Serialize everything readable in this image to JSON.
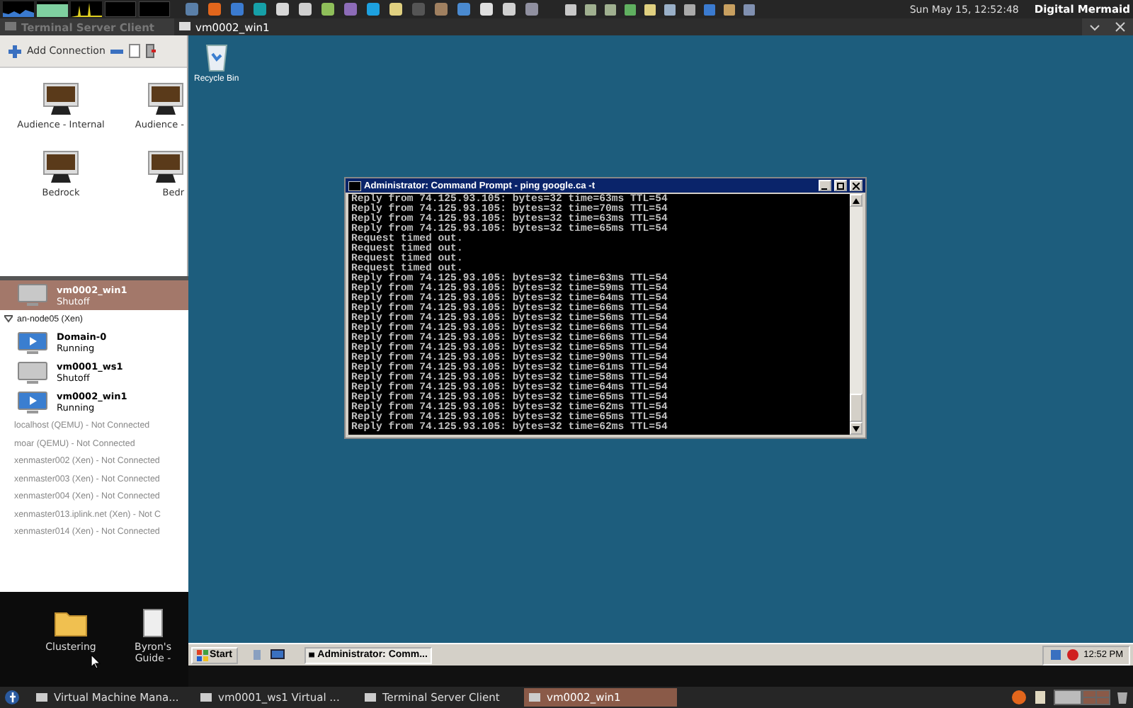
{
  "top_panel": {
    "clock": "Sun May 15, 12:52:48",
    "user": "Digital Mermaid"
  },
  "window_tabs": [
    {
      "label": "Terminal Server Client",
      "selected": false
    },
    {
      "label": "vm0002_win1",
      "selected": true
    }
  ],
  "tsclient": {
    "add_connection": "Add Connection",
    "connections": [
      {
        "label": "Audience - Internal"
      },
      {
        "label": "Audience -"
      },
      {
        "label": "Bedrock"
      },
      {
        "label": "Bedr"
      }
    ]
  },
  "virt_manager": {
    "vms": [
      {
        "name": "vm0002_win1",
        "status": "Shutoff",
        "running": false,
        "selected": true
      }
    ],
    "hosts": [
      {
        "label": "an-node05 (Xen)",
        "connected": true,
        "expanded": true,
        "children": [
          {
            "name": "Domain-0",
            "status": "Running",
            "running": true,
            "selected": false
          },
          {
            "name": "vm0001_ws1",
            "status": "Shutoff",
            "running": false,
            "selected": false
          },
          {
            "name": "vm0002_win1",
            "status": "Running",
            "running": true,
            "selected": false
          }
        ]
      },
      {
        "label": "localhost (QEMU) - Not Connected",
        "connected": false
      },
      {
        "label": "moar (QEMU) - Not Connected",
        "connected": false
      },
      {
        "label": "xenmaster002 (Xen) - Not Connected",
        "connected": false
      },
      {
        "label": "xenmaster003 (Xen) - Not Connected",
        "connected": false
      },
      {
        "label": "xenmaster004 (Xen) - Not Connected",
        "connected": false
      },
      {
        "label": "xenmaster013.iplink.net (Xen) - Not C",
        "connected": false
      },
      {
        "label": "xenmaster014 (Xen) - Not Connected",
        "connected": false
      }
    ]
  },
  "desktop_icons": [
    {
      "label": "Clustering"
    },
    {
      "label": "Byron's Guide -"
    }
  ],
  "guest": {
    "desktop_icons": [
      {
        "label": "Recycle Bin"
      }
    ],
    "cmd": {
      "title": "Administrator: Command Prompt - ping google.ca -t",
      "lines": [
        "Reply from 74.125.93.105: bytes=32 time=63ms TTL=54",
        "Reply from 74.125.93.105: bytes=32 time=70ms TTL=54",
        "Reply from 74.125.93.105: bytes=32 time=63ms TTL=54",
        "Reply from 74.125.93.105: bytes=32 time=65ms TTL=54",
        "Request timed out.",
        "Request timed out.",
        "Request timed out.",
        "Request timed out.",
        "Reply from 74.125.93.105: bytes=32 time=63ms TTL=54",
        "Reply from 74.125.93.105: bytes=32 time=59ms TTL=54",
        "Reply from 74.125.93.105: bytes=32 time=64ms TTL=54",
        "Reply from 74.125.93.105: bytes=32 time=66ms TTL=54",
        "Reply from 74.125.93.105: bytes=32 time=56ms TTL=54",
        "Reply from 74.125.93.105: bytes=32 time=66ms TTL=54",
        "Reply from 74.125.93.105: bytes=32 time=66ms TTL=54",
        "Reply from 74.125.93.105: bytes=32 time=65ms TTL=54",
        "Reply from 74.125.93.105: bytes=32 time=90ms TTL=54",
        "Reply from 74.125.93.105: bytes=32 time=61ms TTL=54",
        "Reply from 74.125.93.105: bytes=32 time=58ms TTL=54",
        "Reply from 74.125.93.105: bytes=32 time=64ms TTL=54",
        "Reply from 74.125.93.105: bytes=32 time=65ms TTL=54",
        "Reply from 74.125.93.105: bytes=32 time=62ms TTL=54",
        "Reply from 74.125.93.105: bytes=32 time=65ms TTL=54",
        "Reply from 74.125.93.105: bytes=32 time=62ms TTL=54"
      ]
    },
    "taskbar": {
      "start": "Start",
      "tasks": [
        {
          "label": "Administrator: Comm...",
          "selected": true
        }
      ],
      "clock": "12:52 PM"
    }
  },
  "bottom_panel": {
    "tasks": [
      {
        "label": "Virtual Machine Mana...",
        "selected": false
      },
      {
        "label": "vm0001_ws1 Virtual ...",
        "selected": false
      },
      {
        "label": "Terminal Server Client",
        "selected": false
      },
      {
        "label": "vm0002_win1",
        "selected": true
      }
    ]
  }
}
